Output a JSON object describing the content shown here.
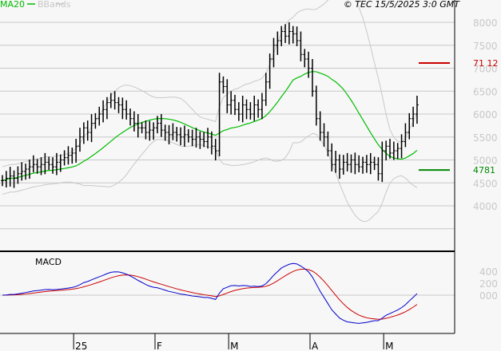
{
  "header": {
    "legend_ma": "MA20",
    "legend_bb": "BBands",
    "copyright": "© TEC 15/5/2025 3:0 GMT"
  },
  "colors": {
    "ma": "#00bb00",
    "bbands": "#c8c8c8",
    "price": "#000000",
    "macd": "#0000cc",
    "signal": "#cc0000",
    "marker_red": "#cc0000",
    "marker_green": "#008800"
  },
  "chart_data": [
    {
      "type": "ohlc",
      "title": "Price",
      "y_ticks": [
        "8000",
        "7500",
        "7000",
        "6500",
        "6000",
        "5500",
        "5000",
        "4500",
        "4000"
      ],
      "ylim": [
        3500,
        8500
      ],
      "x_labels": [
        "25",
        "F",
        "M",
        "A",
        "M"
      ],
      "x_label_index": [
        19,
        40,
        59,
        80,
        99
      ],
      "closes": [
        4550,
        4600,
        4650,
        4600,
        4700,
        4750,
        4800,
        4850,
        4900,
        4850,
        4900,
        4950,
        4900,
        4850,
        4950,
        5000,
        5050,
        5100,
        5150,
        5300,
        5500,
        5700,
        5600,
        5800,
        5900,
        6000,
        6100,
        6250,
        6300,
        6250,
        6200,
        6100,
        6000,
        5900,
        5800,
        5700,
        5700,
        5600,
        5650,
        5700,
        5800,
        5650,
        5600,
        5550,
        5600,
        5550,
        5500,
        5550,
        5500,
        5450,
        5500,
        5450,
        5400,
        5500,
        5300,
        5200,
        6700,
        6600,
        6200,
        6300,
        6100,
        6000,
        6200,
        6100,
        6000,
        6200,
        6100,
        6300,
        6700,
        7200,
        7500,
        7600,
        7800,
        7700,
        7800,
        7750,
        7600,
        7300,
        7200,
        7000,
        6500,
        5900,
        5600,
        5500,
        5200,
        4900,
        5000,
        4800,
        4950,
        4900,
        5000,
        4900,
        4850,
        4950,
        4900,
        4950,
        4900,
        4700,
        5200,
        5300,
        5150,
        5200,
        5250,
        5400,
        5600,
        5900,
        6000,
        6200
      ],
      "series": [
        {
          "name": "MA20",
          "period": 20
        },
        {
          "name": "BBands",
          "period": 20,
          "stdev": 2
        }
      ],
      "markers": [
        {
          "label": "71 12",
          "value": 7112,
          "color": "#cc0000"
        },
        {
          "label": "4781",
          "value": 4781,
          "color": "#008800"
        }
      ]
    },
    {
      "type": "line",
      "title": "MACD",
      "y_ticks": [
        "400",
        "200",
        "000"
      ],
      "ylim": [
        -1100,
        700
      ],
      "series": [
        {
          "name": "MACD",
          "fast": 12,
          "slow": 26
        },
        {
          "name": "Signal",
          "period": 9
        }
      ]
    }
  ]
}
